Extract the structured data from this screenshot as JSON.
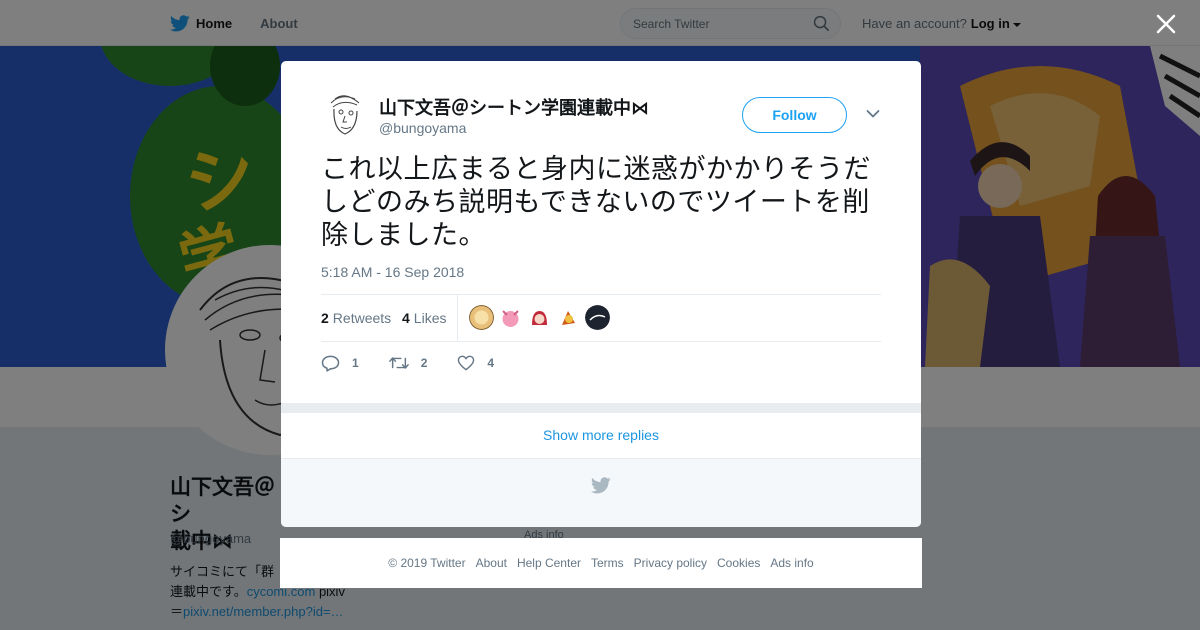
{
  "topbar": {
    "home_label": "Home",
    "about_label": "About",
    "search_placeholder": "Search Twitter",
    "account_prompt": "Have an account?",
    "login_label": "Log in"
  },
  "profile": {
    "name_line1": "山下文吾＠シ",
    "name_line2": "載中⋈",
    "handle": "@bungoyama",
    "bio_line1": "サイコミにて「群",
    "bio_line2_text": "連載中です。",
    "bio_link1": "cycomi.com",
    "bio_line2_tail": " pixiv",
    "bio_line3_prefix": "＝",
    "bio_link2": "pixiv.net/member.php?id=…",
    "ads_info": "Ads info"
  },
  "tweet": {
    "author_name": "山下文吾＠シートン学園連載中⋈",
    "author_handle": "@bungoyama",
    "follow_label": "Follow",
    "text": "これ以上広まると身内に迷惑がかかりそうだしどのみち説明もできないのでツイートを削除しました。",
    "timestamp": "5:18 AM - 16 Sep 2018",
    "retweets_count": "2",
    "retweets_label": "Retweets",
    "likes_count": "4",
    "likes_label": "Likes",
    "reply_count": "1",
    "retweet_action_count": "2",
    "like_action_count": "4",
    "show_more_replies": "Show more replies"
  },
  "footer": {
    "copyright": "© 2019 Twitter",
    "about": "About",
    "help": "Help Center",
    "terms": "Terms",
    "privacy": "Privacy policy",
    "cookies": "Cookies",
    "ads": "Ads info"
  },
  "colors": {
    "accent": "#1da1f2",
    "link": "#1b95e0",
    "banner_blue": "#2f5fd0",
    "banner_green": "#2e8b2e"
  },
  "icons": [
    "twitter-bird-icon",
    "home-icon",
    "search-icon",
    "close-icon",
    "chevron-down-icon",
    "reply-icon",
    "retweet-icon",
    "heart-icon"
  ]
}
